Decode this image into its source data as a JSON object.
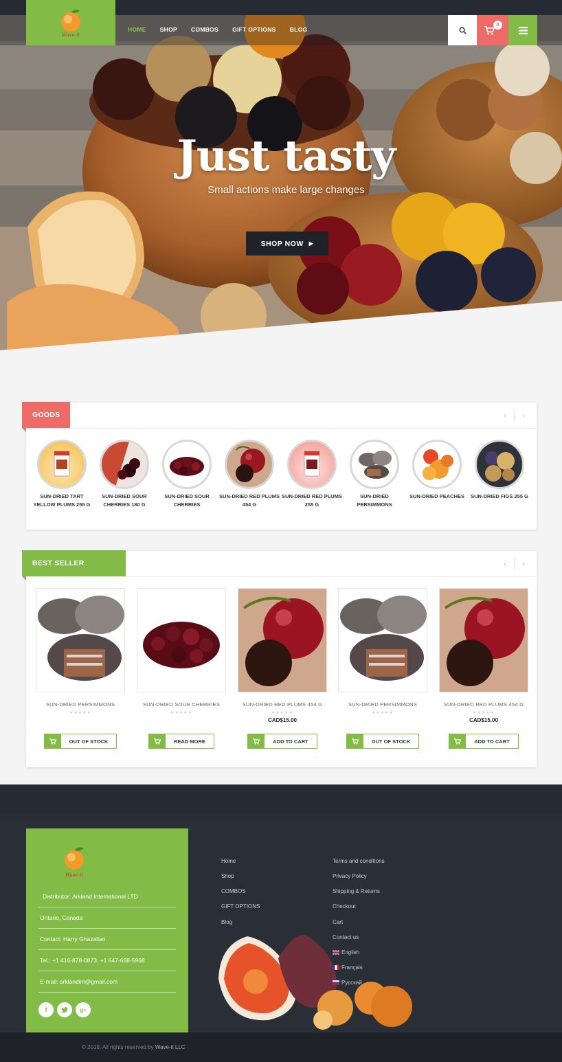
{
  "brand": {
    "logo_text": "Wave-it"
  },
  "nav": {
    "items": [
      "HOME",
      "SHOP",
      "COMBOS",
      "GIFT OPTIONS",
      "BLOG"
    ],
    "active": "HOME",
    "cart_count": "0"
  },
  "hero": {
    "title": "Just tasty",
    "subtitle": "Small actions make large changes",
    "button": "SHOP NOW"
  },
  "goods": {
    "title": "GOODS",
    "items": [
      {
        "name": "SUN-DRIED TART YELLOW PLUMS 255 G"
      },
      {
        "name": "SUN-DRIED SOUR CHERRIES 180 G"
      },
      {
        "name": "SUN-DRIED SOUR CHERRIES"
      },
      {
        "name": "SUN-DRIED RED PLUMS 454 G"
      },
      {
        "name": "SUN-DRIED RED PLUMS 255 G"
      },
      {
        "name": "SUN-DRIED PERSIMMONS"
      },
      {
        "name": "SUN-DRIED PEACHES"
      },
      {
        "name": "SUN-DRIED FIGS 255 G"
      }
    ]
  },
  "best_seller": {
    "title": "BEST SELLER",
    "products": [
      {
        "name": "SUN-DRIED PERSIMMONS",
        "price": "",
        "button": "OUT OF STOCK"
      },
      {
        "name": "SUN-DRIED SOUR CHERRIES",
        "price": "",
        "button": "READ MORE"
      },
      {
        "name": "SUN-DRIED RED PLUMS 454 G",
        "price": "CAD$15.00",
        "button": "ADD TO CART"
      },
      {
        "name": "SUN-DRIED PERSIMMONS",
        "price": "",
        "button": "OUT OF STOCK"
      },
      {
        "name": "SUN-DRIED RED PLUMS 454 G",
        "price": "CAD$15.00",
        "button": "ADD TO CART"
      }
    ],
    "stars": "★★★★★"
  },
  "footer": {
    "distributor": "Distributor: Arkland International LTD",
    "location": "Ontario, Canada",
    "contact": "Contact: Harry Ghazalian",
    "tel": "Tel.: +1 416-878-0873, +1 647-668-5968",
    "email": "E-mail: arklandint@gmail.com",
    "links_col1": [
      "Home",
      "Shop",
      "COMBOS",
      "GIFT OPTIONS",
      "Blog"
    ],
    "links_col2": [
      "Terms and conditions",
      "Privacy Policy",
      "Shipping & Returns",
      "Checkout",
      "Cart",
      "Contact us"
    ],
    "languages": [
      "English",
      "Français",
      "Русский"
    ],
    "copyright": "© 2019. All rights reserved by",
    "company": "Wave-it LLC"
  },
  "colors": {
    "green": "#82bc46",
    "coral": "#ee6b68",
    "dark": "#262a33"
  }
}
